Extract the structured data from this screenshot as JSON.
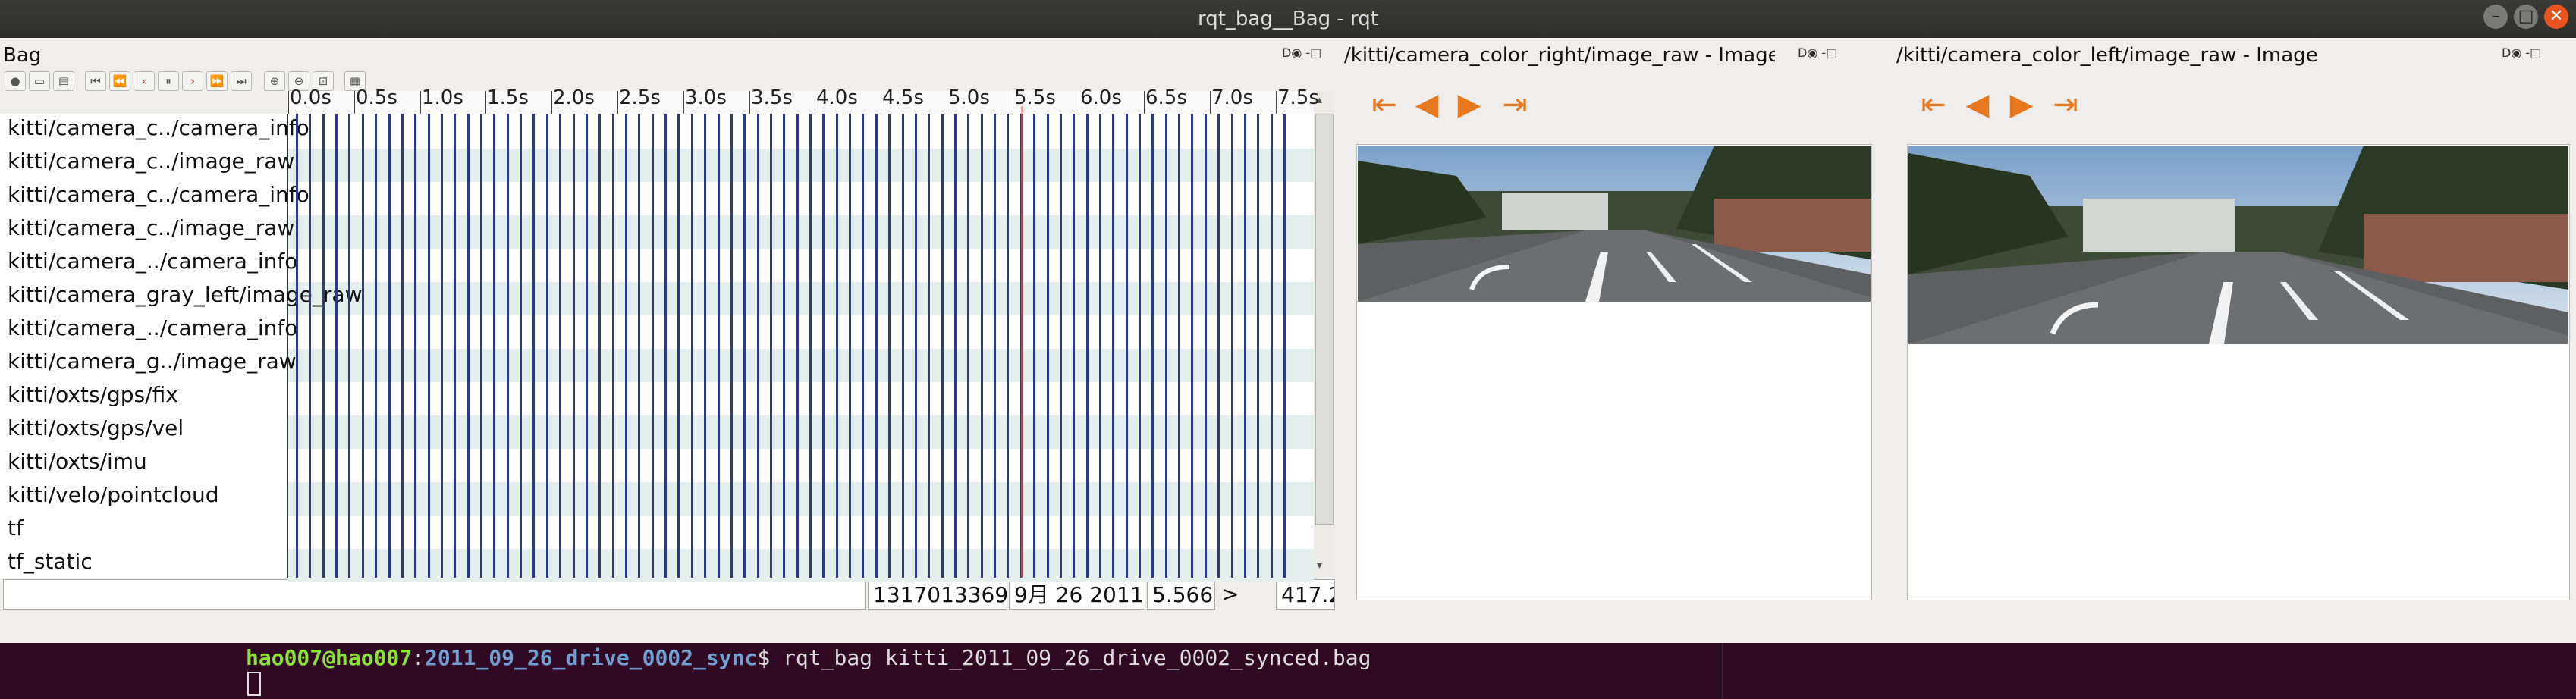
{
  "window": {
    "title": "rqt_bag__Bag - rqt",
    "controls": [
      "minimize",
      "maximize",
      "close"
    ]
  },
  "bag_panel": {
    "title": "Bag",
    "dock_controls": "D◉ -□",
    "ruler_labels": [
      "0.0s",
      "0.5s",
      "1.0s",
      "1.5s",
      "2.0s",
      "2.5s",
      "3.0s",
      "3.5s",
      "4.0s",
      "4.5s",
      "5.0s",
      "5.5s",
      "6.0s",
      "6.5s",
      "7.0s",
      "7.5s"
    ],
    "topics": [
      "kitti/camera_c../camera_info",
      "kitti/camera_c../image_raw",
      "kitti/camera_c../camera_info",
      "kitti/camera_c../image_raw",
      "kitti/camera_../camera_info",
      "kitti/camera_gray_left/image_raw",
      "kitti/camera_../camera_info",
      "kitti/camera_g../image_raw",
      "kitti/oxts/gps/fix",
      "kitti/oxts/gps/vel",
      "kitti/oxts/imu",
      "kitti/velo/pointcloud",
      "tf",
      "tf_static"
    ],
    "playhead_time": 5.566,
    "status": {
      "filter_value": "",
      "stamp": "1317013369.:",
      "date": "9月 26 2011 1",
      "elapsed": "5.566s",
      "play": ">",
      "size": "417.2"
    }
  },
  "image_panel_right": {
    "title": "/kitti/camera_color_right/image_raw - Image",
    "dock_controls": "D◉ -□"
  },
  "image_panel_left": {
    "title": "/kitti/camera_color_left/image_raw - Image",
    "dock_controls": "D◉ -□"
  },
  "terminal": {
    "user_host": "hao007@hao007",
    "path": "2011_09_26_drive_0002_sync",
    "prompt": "$ ",
    "command": "rqt_bag kitti_2011_09_26_drive_0002_synced.bag"
  },
  "colors": {
    "titlebar": "#2e2e2c",
    "close_button": "#e9541f",
    "message_line": "#2a3a88",
    "row_alt": "#e2efec",
    "nav_arrow": "#e8781e",
    "terminal_bg": "#300a24",
    "terminal_user": "#8ae234",
    "terminal_path": "#729fcf"
  },
  "icons": {
    "nav_buttons": [
      "skip-to-start-icon",
      "step-back-icon",
      "step-forward-icon",
      "skip-to-end-icon"
    ]
  }
}
